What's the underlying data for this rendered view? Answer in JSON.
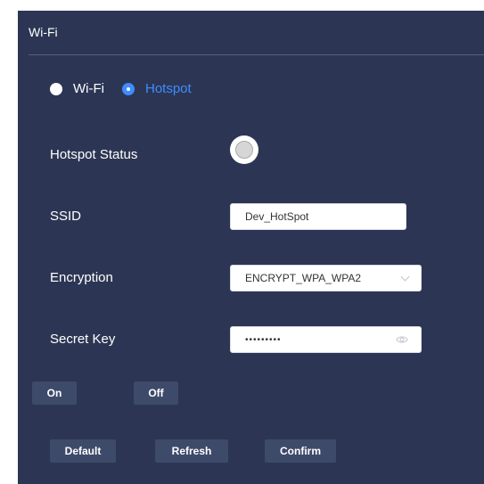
{
  "panel": {
    "title": "Wi-Fi"
  },
  "mode": {
    "options": [
      {
        "label": "Wi-Fi",
        "checked": false
      },
      {
        "label": "Hotspot",
        "checked": true
      }
    ]
  },
  "fields": {
    "hotspot_status": {
      "label": "Hotspot Status",
      "value": "off"
    },
    "ssid": {
      "label": "SSID",
      "value": "Dev_HotSpot"
    },
    "encryption": {
      "label": "Encryption",
      "value": "ENCRYPT_WPA_WPA2"
    },
    "secret_key": {
      "label": "Secret Key",
      "value": "•••••••••",
      "icon": "eye-icon"
    }
  },
  "buttons": {
    "on": "On",
    "off": "Off",
    "default": "Default",
    "refresh": "Refresh",
    "confirm": "Confirm"
  },
  "colors": {
    "panel_bg": "#2c3654",
    "accent": "#3f8cff",
    "button_bg": "#3e4a69"
  }
}
